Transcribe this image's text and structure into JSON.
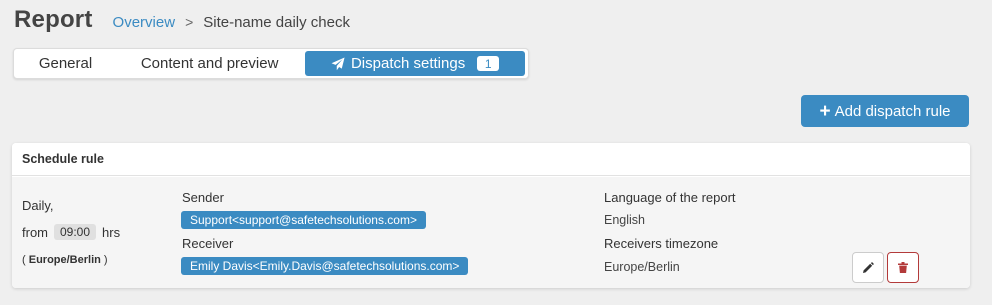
{
  "header": {
    "title": "Report",
    "breadcrumb": {
      "link": "Overview",
      "separator": ">",
      "current": "Site-name daily check"
    }
  },
  "tabs": {
    "general": "General",
    "content": "Content and preview",
    "dispatch": "Dispatch settings",
    "dispatch_badge": "1",
    "active": "dispatch",
    "dispatch_icon": "paper-plane-icon"
  },
  "actions": {
    "add_rule_label": "Add dispatch rule",
    "add_icon": "plus-icon"
  },
  "rule_card": {
    "title": "Schedule rule",
    "schedule": {
      "frequency": "Daily,",
      "from_label": "from",
      "time": "09:00",
      "hrs_label": "hrs",
      "open_paren": "(",
      "timezone": "Europe/Berlin",
      "close_paren": ")"
    },
    "sender_label": "Sender",
    "sender": "Support<support@safetechsolutions.com>",
    "receiver_label": "Receiver",
    "receiver": "Emily Davis<Emily.Davis@safetechsolutions.com>",
    "language_label": "Language of the report",
    "language": "English",
    "receivers_tz_label": "Receivers timezone",
    "receivers_tz": "Europe/Berlin",
    "edit_icon": "pencil-icon",
    "delete_icon": "trash-icon"
  },
  "colors": {
    "accent": "#3b8bc2",
    "danger": "#b33a3a",
    "background": "#efefef"
  }
}
